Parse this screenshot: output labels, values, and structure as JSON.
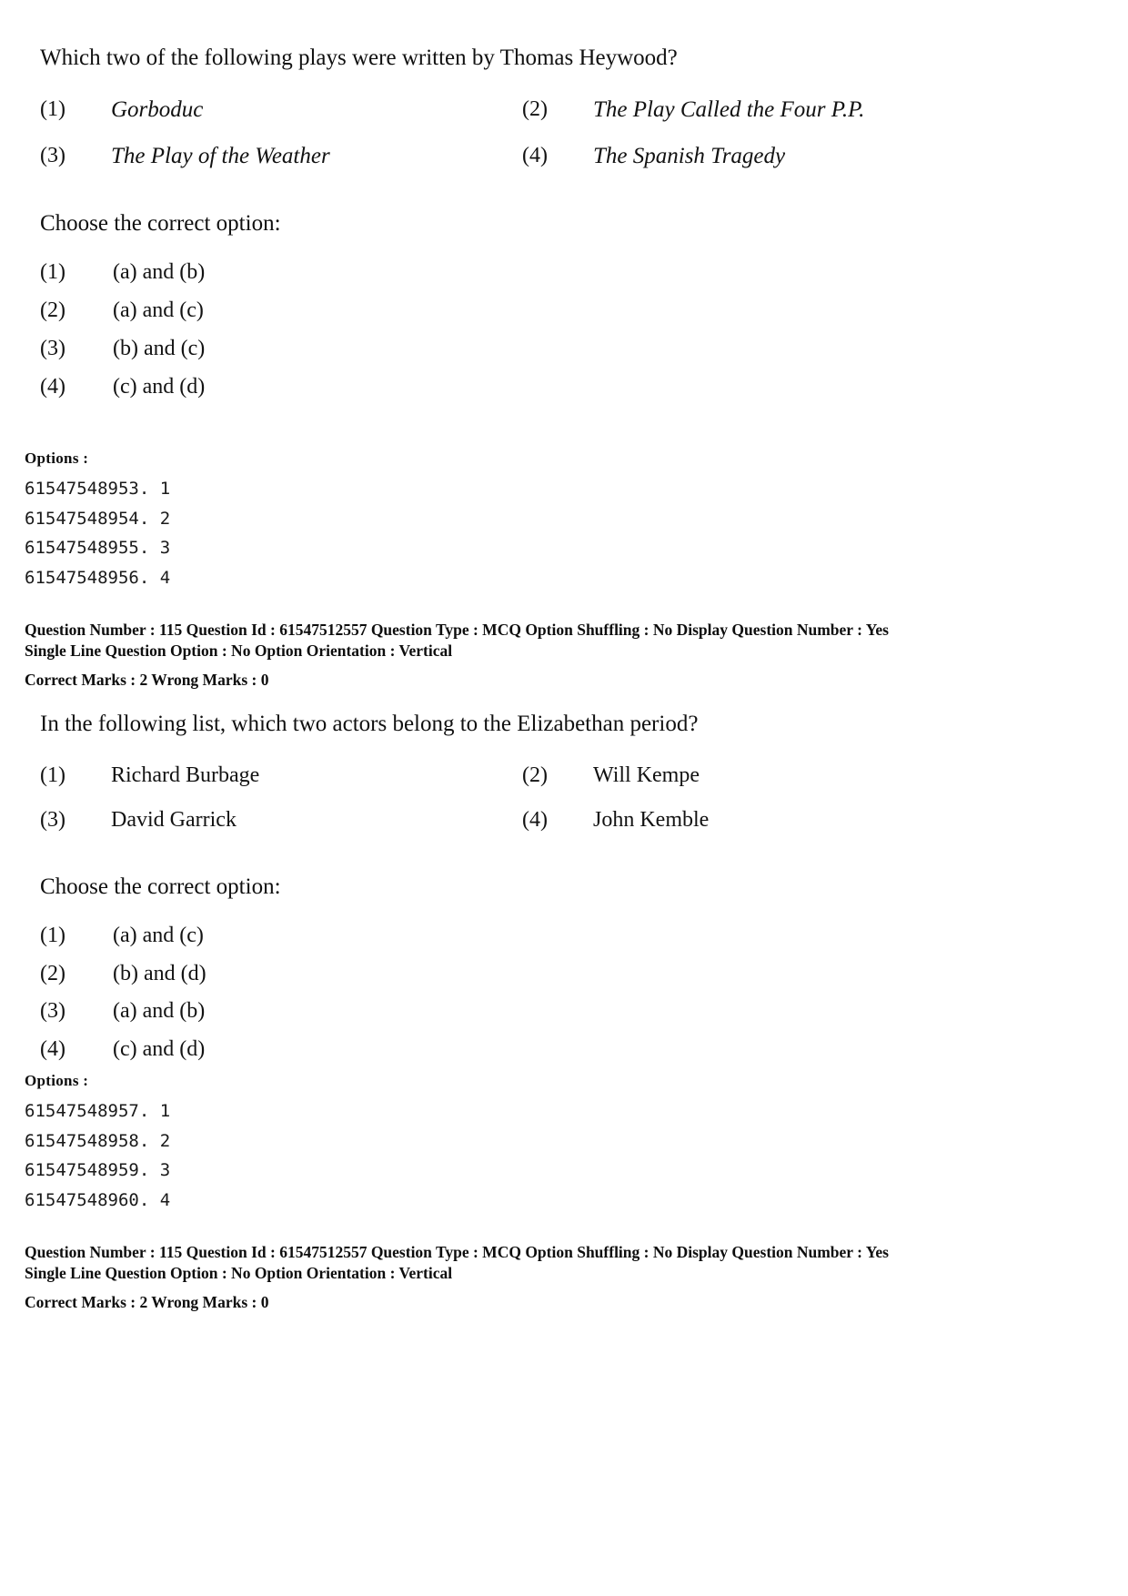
{
  "document": {
    "page_type": "exam-question-paper",
    "background_color": "#ffffff",
    "text_color": "#121212"
  },
  "questions": [
    {
      "stem": "Which two of the following plays were written by Thomas Heywood?",
      "choices": [
        {
          "num": "(1)",
          "text": "Gorboduc",
          "italic": true
        },
        {
          "num": "(2)",
          "text": "The Play Called the Four P.P.",
          "italic": true
        },
        {
          "num": "(3)",
          "text": "The Play of the Weather",
          "italic": true
        },
        {
          "num": "(4)",
          "text": "The Spanish Tragedy",
          "italic": true
        }
      ],
      "choose_prompt": "Choose the correct option:",
      "answers": [
        {
          "num": "(1)",
          "text": "(a) and (b)"
        },
        {
          "num": "(2)",
          "text": "(a) and (c)"
        },
        {
          "num": "(3)",
          "text": "(b) and (c)"
        },
        {
          "num": "(4)",
          "text": "(c) and (d)"
        }
      ],
      "options_label": "Options :",
      "option_ids": [
        "61547548953. 1",
        "61547548954. 2",
        "61547548955. 3",
        "61547548956. 4"
      ],
      "metadata": {
        "line1": "Question Number : 115  Question Id : 61547512557  Question Type : MCQ  Option Shuffling : No  Display Question Number : Yes",
        "line2": "Single Line Question Option : No  Option Orientation : Vertical",
        "line3": "Correct Marks : 2  Wrong Marks : 0"
      }
    },
    {
      "stem": "In the following list, which two actors belong to the Elizabethan period?",
      "choices": [
        {
          "num": "(1)",
          "text": "Richard Burbage",
          "italic": false
        },
        {
          "num": "(2)",
          "text": "Will Kempe",
          "italic": false
        },
        {
          "num": "(3)",
          "text": "David Garrick",
          "italic": false
        },
        {
          "num": "(4)",
          "text": "John Kemble",
          "italic": false
        }
      ],
      "choose_prompt": "Choose the correct option:",
      "answers": [
        {
          "num": "(1)",
          "text": "(a) and (c)"
        },
        {
          "num": "(2)",
          "text": "(b) and (d)"
        },
        {
          "num": "(3)",
          "text": "(a) and (b)"
        },
        {
          "num": "(4)",
          "text": "(c) and (d)"
        }
      ],
      "options_label": "Options :",
      "option_ids": [
        "61547548957. 1",
        "61547548958. 2",
        "61547548959. 3",
        "61547548960. 4"
      ],
      "metadata": {
        "line1": "Question Number : 115  Question Id : 61547512557  Question Type : MCQ  Option Shuffling : No  Display Question Number : Yes",
        "line2": "Single Line Question Option : No  Option Orientation : Vertical",
        "line3": "Correct Marks : 2  Wrong Marks : 0"
      }
    }
  ]
}
